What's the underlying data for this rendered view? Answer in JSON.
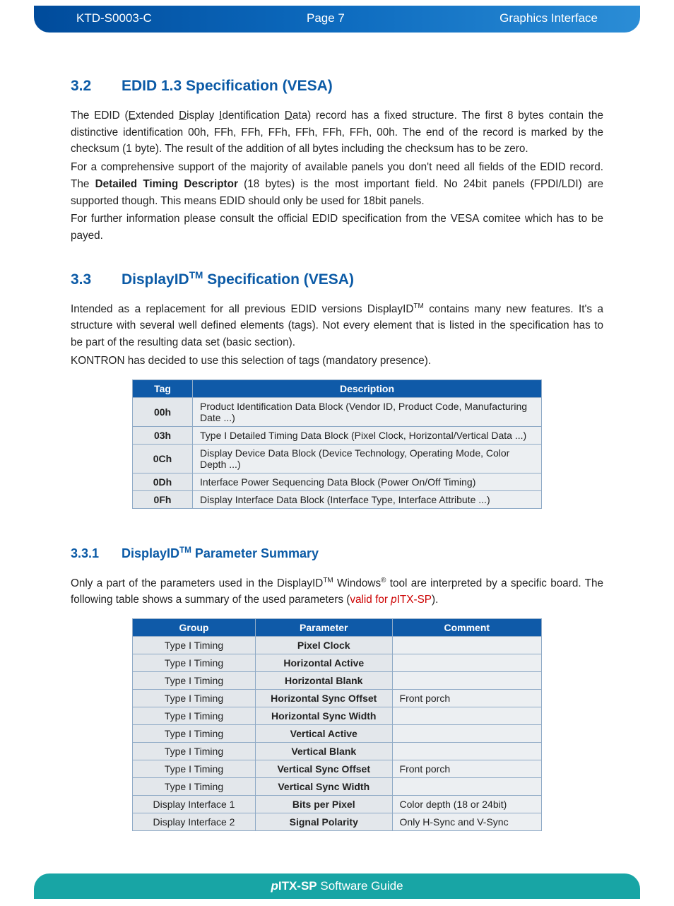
{
  "header": {
    "doc_id": "KTD-S0003-C",
    "page": "Page 7",
    "section": "Graphics Interface"
  },
  "section_3_2": {
    "num": "3.2",
    "title_rest": "EDID 1.3 Specification (VESA)",
    "p1_a": "The EDID (",
    "p1_E": "E",
    "p1_b": "xtended ",
    "p1_D": "D",
    "p1_c": "isplay ",
    "p1_I": "I",
    "p1_d": "dentification ",
    "p1_D2": "D",
    "p1_e": "ata) record has a fixed structure. The first 8 bytes contain the distinctive identification 00h, FFh, FFh, FFh, FFh, FFh, FFh, 00h. The end of the record is marked by the checksum (1 byte). The result of the addition of all bytes including the checksum has to be zero.",
    "p2_a": "For a comprehensive support of the majority of available panels you don't need all fields of the EDID record. The ",
    "p2_bold": "Detailed Timing Descriptor",
    "p2_b": " (18 bytes) is the most important field. No 24bit panels (FPDI/LDI) are supported though. This means EDID should only be used for 18bit panels.",
    "p3": "For further information please consult the official EDID specification from the VESA comitee which has to be payed."
  },
  "section_3_3": {
    "num": "3.3",
    "title_a": "DisplayID",
    "title_sup": "TM",
    "title_b": " Specification (VESA)",
    "p1_a": "Intended as a replacement for all previous EDID versions DisplayID",
    "p1_sup": "TM",
    "p1_b": " contains many new features. It's a structure with several well defined elements (tags). Not every element that is listed in the specification has to be part of the resulting data set (basic section).",
    "p2": "KONTRON has decided to use this selection of tags (mandatory presence).",
    "table1": {
      "headers": {
        "tag": "Tag",
        "desc": "Description"
      },
      "rows": [
        {
          "tag": "00h",
          "desc": "Product Identification Data Block (Vendor ID, Product Code, Manufacturing Date ...)"
        },
        {
          "tag": "03h",
          "desc": "Type I Detailed Timing Data Block (Pixel Clock, Horizontal/Vertical Data ...)"
        },
        {
          "tag": "0Ch",
          "desc": "Display Device Data Block (Device Technology, Operating Mode, Color Depth ...)"
        },
        {
          "tag": "0Dh",
          "desc": "Interface Power Sequencing Data Block (Power On/Off Timing)"
        },
        {
          "tag": "0Fh",
          "desc": "Display Interface Data Block (Interface Type, Interface Attribute ...)"
        }
      ]
    }
  },
  "section_3_3_1": {
    "num": "3.3.1",
    "title_a": "DisplayID",
    "title_sup": "TM",
    "title_b": " Parameter Summary",
    "p1_a": "Only a part of the parameters used in the DisplayID",
    "p1_sup1": "TM",
    "p1_b": " Windows",
    "p1_sup2": "®",
    "p1_c": " tool are interpreted by a specific board. The following table shows a summary of the used parameters (",
    "p1_red_a": "valid for ",
    "p1_red_it": "p",
    "p1_red_b": "ITX-SP",
    "p1_d": ").",
    "table2": {
      "headers": {
        "group": "Group",
        "param": "Parameter",
        "comment": "Comment"
      },
      "rows": [
        {
          "group": "Type I Timing",
          "param": "Pixel Clock",
          "comment": ""
        },
        {
          "group": "Type I Timing",
          "param": "Horizontal Active",
          "comment": ""
        },
        {
          "group": "Type I Timing",
          "param": "Horizontal Blank",
          "comment": ""
        },
        {
          "group": "Type I Timing",
          "param": "Horizontal Sync Offset",
          "comment": "Front porch"
        },
        {
          "group": "Type I Timing",
          "param": "Horizontal Sync Width",
          "comment": ""
        },
        {
          "group": "Type I Timing",
          "param": "Vertical Active",
          "comment": ""
        },
        {
          "group": "Type I Timing",
          "param": "Vertical Blank",
          "comment": ""
        },
        {
          "group": "Type I Timing",
          "param": "Vertical Sync Offset",
          "comment": "Front porch"
        },
        {
          "group": "Type I Timing",
          "param": "Vertical Sync Width",
          "comment": ""
        },
        {
          "group": "Display Interface 1",
          "param": "Bits per Pixel",
          "comment": "Color depth (18 or 24bit)"
        },
        {
          "group": "Display Interface 2",
          "param": "Signal Polarity",
          "comment": "Only H-Sync and V-Sync"
        }
      ]
    }
  },
  "footer": {
    "it": "p",
    "bold": "ITX-SP",
    "rest": " Software Guide"
  }
}
